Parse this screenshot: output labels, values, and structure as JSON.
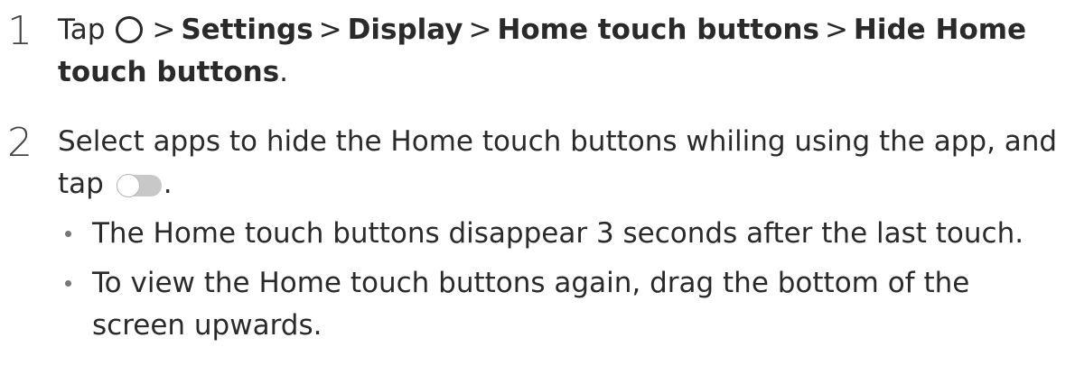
{
  "steps": [
    {
      "number": "1",
      "text_before": "Tap",
      "icon": "home-circle-icon",
      "sep": ">",
      "path": [
        "Settings",
        "Display",
        "Home touch buttons",
        "Hide Home touch buttons"
      ],
      "end": "."
    },
    {
      "number": "2",
      "text": "Select apps to hide the Home touch buttons whiling using the app, and tap",
      "icon": "toggle-switch-icon",
      "end": "."
    }
  ],
  "bullets": [
    "The Home touch buttons disappear 3 seconds after the last touch.",
    "To view the Home touch buttons again, drag the bottom of the screen upwards."
  ]
}
